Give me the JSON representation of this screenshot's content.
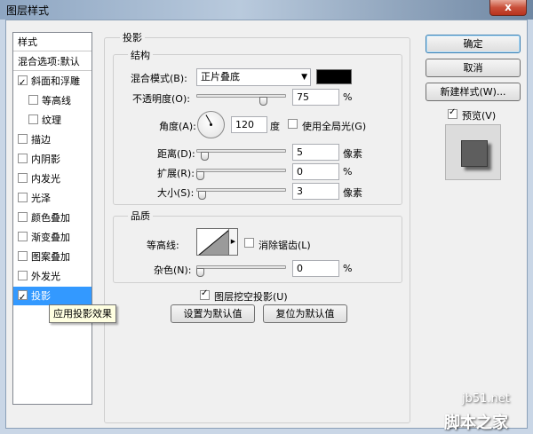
{
  "window": {
    "title": "图层样式",
    "close_label": "x"
  },
  "style_list": {
    "header_styles": "样式",
    "header_blend": "混合选项:默认",
    "items": [
      {
        "label": "斜面和浮雕",
        "checked": false
      },
      {
        "label": "等高线",
        "checked": false
      },
      {
        "label": "纹理",
        "checked": false
      },
      {
        "label": "描边",
        "checked": false
      },
      {
        "label": "内阴影",
        "checked": false
      },
      {
        "label": "内发光",
        "checked": false
      },
      {
        "label": "光泽",
        "checked": false
      },
      {
        "label": "颜色叠加",
        "checked": false
      },
      {
        "label": "渐变叠加",
        "checked": false
      },
      {
        "label": "图案叠加",
        "checked": false
      },
      {
        "label": "外发光",
        "checked": false
      },
      {
        "label": "投影",
        "checked": true
      }
    ],
    "tooltip": "应用投影效果"
  },
  "drop_shadow": {
    "section_title": "投影",
    "structure": {
      "title": "结构",
      "blend_mode_label": "混合模式(B):",
      "blend_mode_value": "正片叠底",
      "shadow_color": "#000000",
      "opacity_label": "不透明度(O):",
      "opacity_value": "75",
      "percent": "%",
      "angle_label": "角度(A):",
      "angle_value": "120",
      "degree_unit": "度",
      "global_light_label": "使用全局光(G)",
      "global_light_checked": false,
      "distance_label": "距离(D):",
      "distance_value": "5",
      "pixel_unit": "像素",
      "spread_label": "扩展(R):",
      "spread_value": "0",
      "size_label": "大小(S):",
      "size_value": "3"
    },
    "quality": {
      "title": "品质",
      "contour_label": "等高线:",
      "anti_alias_label": "消除锯齿(L)",
      "anti_alias_checked": false,
      "noise_label": "杂色(N):",
      "noise_value": "0"
    },
    "knockout_label": "图层挖空投影(U)",
    "knockout_checked": true,
    "make_default_label": "设置为默认值",
    "reset_default_label": "复位为默认值"
  },
  "buttons": {
    "ok": "确定",
    "cancel": "取消",
    "new_style": "新建样式(W)...",
    "preview_label": "预览(V)",
    "preview_checked": true
  },
  "watermark": {
    "site": "jb51.net",
    "brand": "脚本之家"
  }
}
